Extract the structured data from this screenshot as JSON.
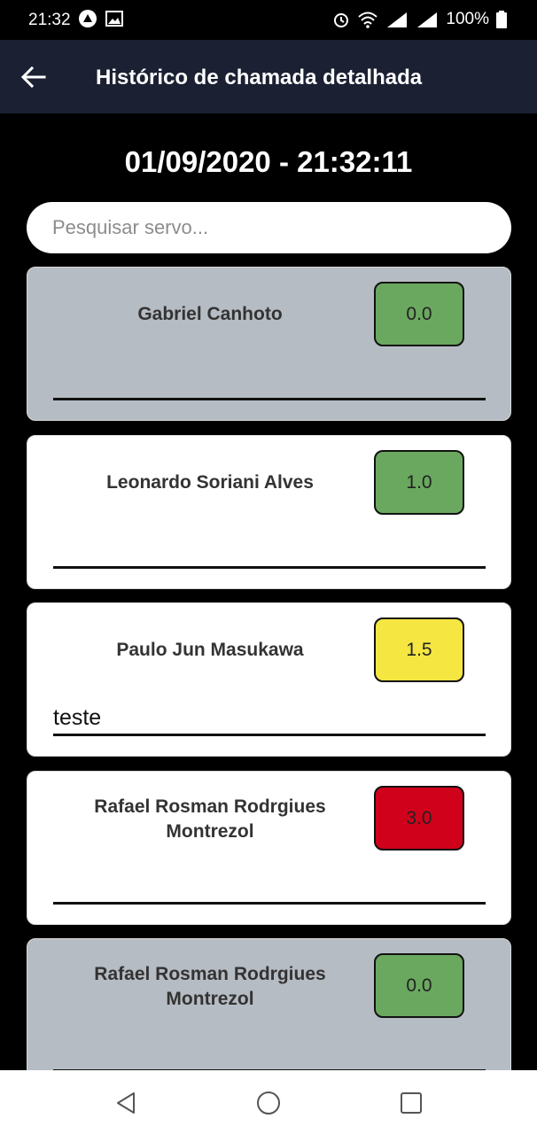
{
  "status_bar": {
    "time": "21:32",
    "battery": "100%"
  },
  "header": {
    "title": "Histórico de chamada detalhada",
    "back_icon": "arrow-left-icon"
  },
  "datetime": "01/09/2020 - 21:32:11",
  "search": {
    "placeholder": "Pesquisar servo...",
    "value": ""
  },
  "colors": {
    "header_bg": "#1b2133",
    "absent_card": "#b6bcc3",
    "present_card": "#ffffff",
    "green": "#6aa85f",
    "yellow": "#f5e642",
    "red": "#d0021b"
  },
  "servants": [
    {
      "name": "Gabriel Canhoto",
      "score": "0.0",
      "score_color": "green",
      "status": "absent",
      "note": ""
    },
    {
      "name": "Leonardo Soriani Alves",
      "score": "1.0",
      "score_color": "green",
      "status": "present",
      "note": ""
    },
    {
      "name": "Paulo Jun Masukawa",
      "score": "1.5",
      "score_color": "yellow",
      "status": "present",
      "note": "teste"
    },
    {
      "name": "Rafael Rosman Rodrgiues Montrezol",
      "score": "3.0",
      "score_color": "red",
      "status": "present",
      "note": ""
    },
    {
      "name": "Rafael Rosman Rodrgiues Montrezol",
      "score": "0.0",
      "score_color": "green",
      "status": "absent",
      "note": ""
    }
  ],
  "nav": {
    "back": "nav-back-icon",
    "home": "nav-home-icon",
    "recents": "nav-recents-icon"
  }
}
